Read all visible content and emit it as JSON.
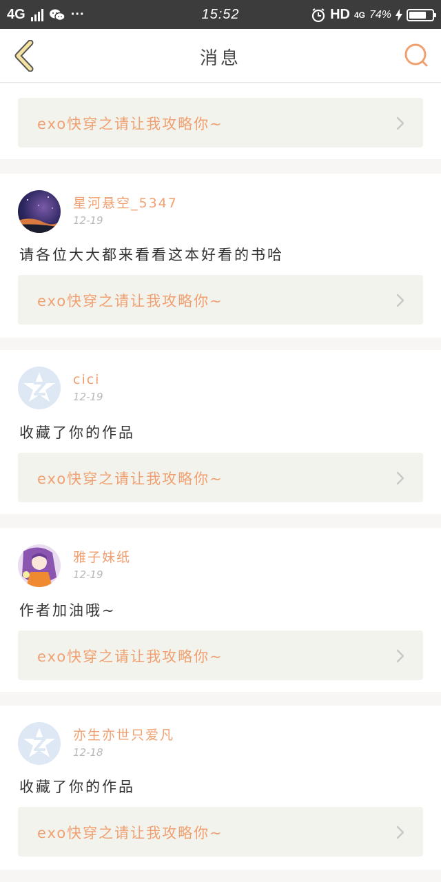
{
  "status_bar": {
    "network": "4G",
    "time": "15:52",
    "hd": "HD",
    "network2": "4G",
    "battery": "74%",
    "battery_level": 0.74,
    "more": "···"
  },
  "header": {
    "title": "消息"
  },
  "icons": {
    "back": "chevron-left-icon",
    "search": "search-icon",
    "arrow": "chevron-right-icon"
  },
  "colors": {
    "accent": "#f0a070",
    "link_bg": "#f3f3ee",
    "back_yellow": "#f5e2a0"
  },
  "messages": [
    {
      "link": "exo快穿之请让我攻略你~"
    },
    {
      "name": "星河悬空_5347",
      "date": "12-19",
      "text": "请各位大大都来看看这本好看的书哈",
      "link": "exo快穿之请让我攻略你~"
    },
    {
      "name": "cici",
      "date": "12-19",
      "text": "收藏了你的作品",
      "link": "exo快穿之请让我攻略你~"
    },
    {
      "name": "雅子妹纸",
      "date": "12-19",
      "text": "作者加油哦~",
      "link": "exo快穿之请让我攻略你~"
    },
    {
      "name": "亦生亦世只爱凡",
      "date": "12-18",
      "text": "收藏了你的作品",
      "link": "exo快穿之请让我攻略你~"
    }
  ]
}
